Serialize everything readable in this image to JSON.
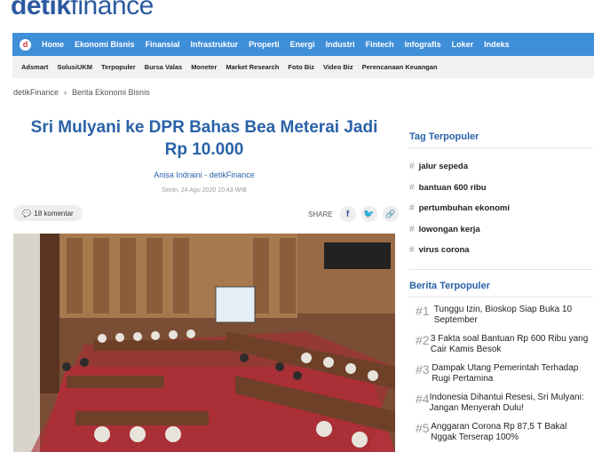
{
  "logo": {
    "bold": "detik",
    "thin": "finance"
  },
  "nav_primary": [
    "Home",
    "Ekonomi Bisnis",
    "Finansial",
    "Infrastruktur",
    "Properti",
    "Energi",
    "Industri",
    "Fintech",
    "Infografis",
    "Loker",
    "Indeks"
  ],
  "nav_secondary": [
    "Adsmart",
    "SolusiUKM",
    "Terpopuler",
    "Bursa Valas",
    "Moneter",
    "Market Research",
    "Foto Biz",
    "Video Biz",
    "Perencanaan Keuangan"
  ],
  "breadcrumb": [
    "detikFinance",
    "Berita Ekonomi Bisnis"
  ],
  "article": {
    "title": "Sri Mulyani ke DPR Bahas Bea Meterai Jadi Rp 10.000",
    "author": "Anisa Indraini - detikFinance",
    "date": "Senin, 24 Agu 2020 10:43 WIB",
    "comments": "18 komentar",
    "share_label": "SHARE"
  },
  "sidebar": {
    "tag_heading": "Tag Terpopuler",
    "tags": [
      "jalur sepeda",
      "bantuan 600 ribu",
      "pertumbuhan ekonomi",
      "lowongan kerja",
      "virus corona"
    ],
    "popular_heading": "Berita Terpopuler",
    "popular": [
      {
        "num": "#1",
        "title": "Tunggu Izin, Bioskop Siap Buka 10 September"
      },
      {
        "num": "#2",
        "title": "3 Fakta soal Bantuan Rp 600 Ribu yang Cair Kamis Besok"
      },
      {
        "num": "#3",
        "title": "Dampak Utang Pemerintah Terhadap Rugi Pertamina"
      },
      {
        "num": "#4",
        "title": "Indonesia Dihantui Resesi, Sri Mulyani: Jangan Menyerah Dulu!"
      },
      {
        "num": "#5",
        "title": "Anggaran Corona Rp 87,5 T Bakal Nggak Terserap 100%"
      }
    ]
  },
  "colors": {
    "brand": "#2a62a8",
    "nav": "#3f8ed8",
    "subnav": "#f2f2f2"
  }
}
